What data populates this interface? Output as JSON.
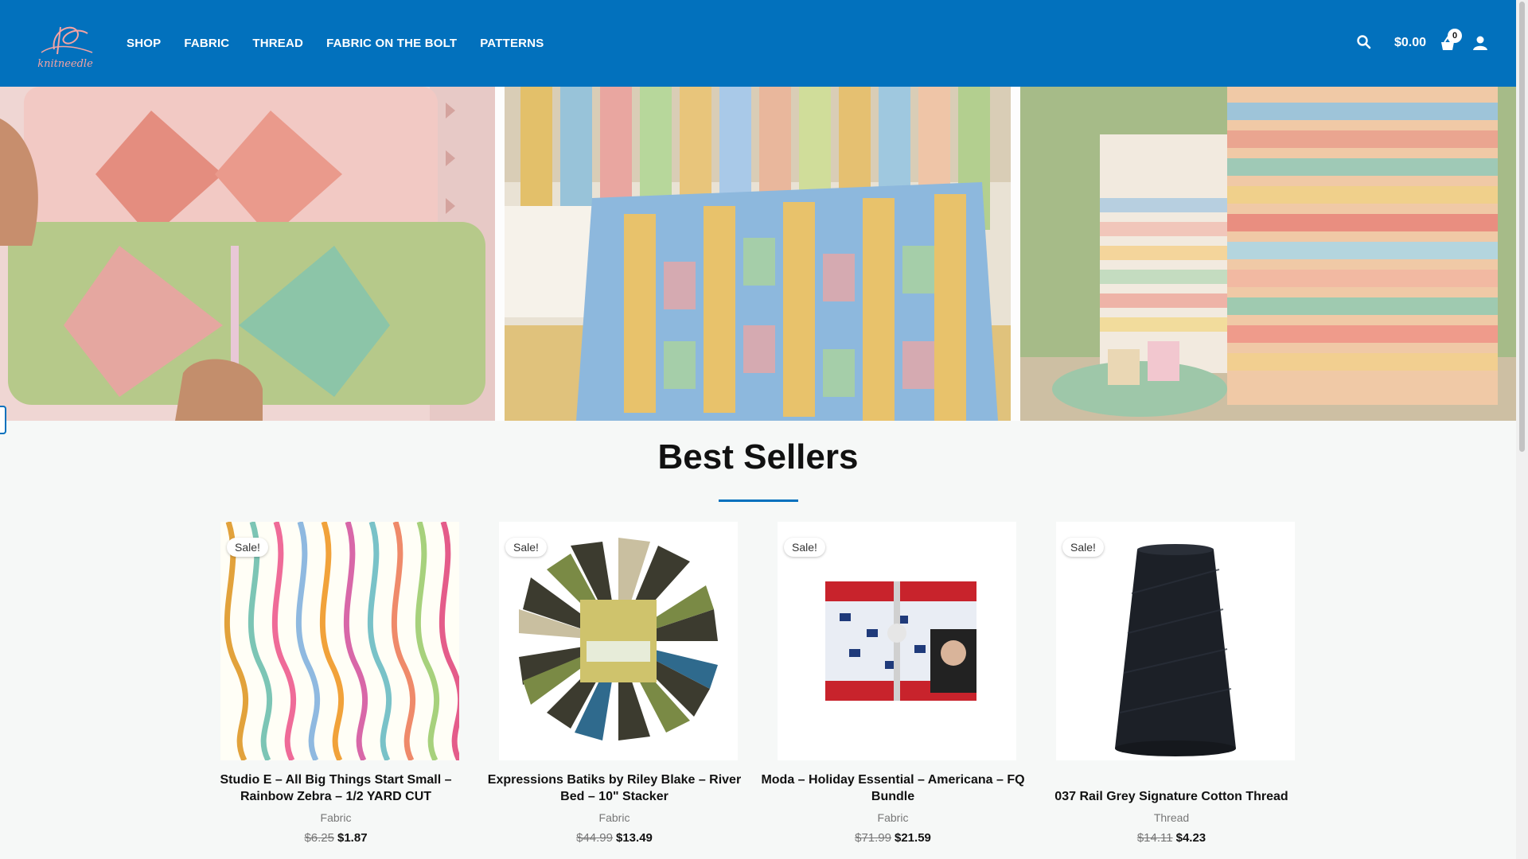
{
  "brand": {
    "logo_text": "knitneedle",
    "colors": {
      "primary": "#0271bd",
      "background": "#f6f8f7"
    }
  },
  "nav": {
    "items": [
      {
        "label": "SHOP"
      },
      {
        "label": "FABRIC"
      },
      {
        "label": "THREAD"
      },
      {
        "label": "FABRIC ON THE BOLT"
      },
      {
        "label": "PATTERNS"
      }
    ]
  },
  "header_actions": {
    "search_icon": "search-icon",
    "cart_total": "$0.00",
    "cart_icon": "basket-icon",
    "cart_count": "0",
    "account_icon": "user-icon"
  },
  "hero": {
    "panels": [
      {
        "name": "butterfly-pillows-image"
      },
      {
        "name": "quilt-on-bench-image"
      },
      {
        "name": "fabric-stack-image"
      }
    ]
  },
  "best_sellers": {
    "title": "Best Sellers",
    "products": [
      {
        "sale_label": "Sale!",
        "name": "Studio E – All Big Things Start Small – Rainbow Zebra – 1/2 YARD CUT",
        "category": "Fabric",
        "old_price": "$6.25",
        "price": "$1.87"
      },
      {
        "sale_label": "Sale!",
        "name": "Expressions Batiks by Riley Blake – River Bed – 10\" Stacker",
        "category": "Fabric",
        "old_price": "$44.99",
        "price": "$13.49"
      },
      {
        "sale_label": "Sale!",
        "name": "Moda – Holiday Essential – Americana – FQ Bundle",
        "category": "Fabric",
        "old_price": "$71.99",
        "price": "$21.59"
      },
      {
        "sale_label": "Sale!",
        "name": "037 Rail Grey Signature Cotton Thread",
        "category": "Thread",
        "old_price": "$14.11",
        "price": "$4.23"
      }
    ]
  }
}
